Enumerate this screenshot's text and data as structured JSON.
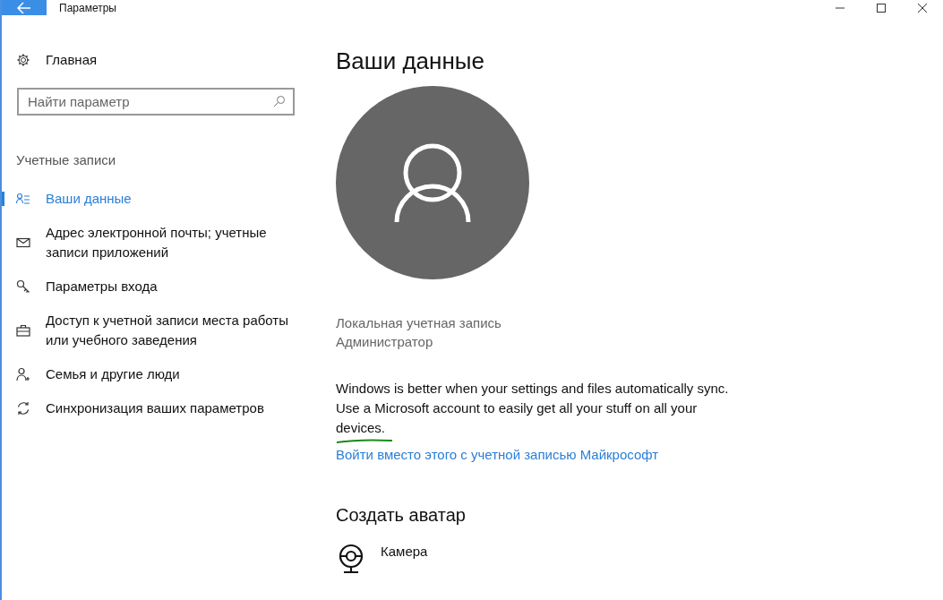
{
  "window": {
    "title": "Параметры"
  },
  "sidebar": {
    "home": "Главная",
    "search": {
      "placeholder": "Найти параметр"
    },
    "section": "Учетные записи",
    "items": [
      {
        "label": "Ваши данные",
        "kind": "profile",
        "selected": true
      },
      {
        "label": "Адрес электронной почты; учетные записи приложений",
        "kind": "email",
        "selected": false
      },
      {
        "label": "Параметры входа",
        "kind": "signin",
        "selected": false
      },
      {
        "label": "Доступ к учетной записи места работы или учебного заведения",
        "kind": "work",
        "selected": false
      },
      {
        "label": "Семья и другие люди",
        "kind": "family",
        "selected": false
      },
      {
        "label": "Синхронизация ваших параметров",
        "kind": "sync",
        "selected": false
      }
    ]
  },
  "content": {
    "title": "Ваши данные",
    "account_type": "Локальная учетная запись",
    "role": "Администратор",
    "message": "Windows is better when your settings and files automatically sync. Use a Microsoft account to easily get all your stuff on all your devices.",
    "link": "Войти вместо этого с учетной записью Майкрософт",
    "avatar_section": "Создать аватар",
    "avatar_options": [
      {
        "label": "Камера"
      }
    ]
  }
}
